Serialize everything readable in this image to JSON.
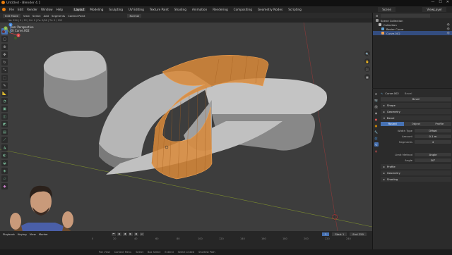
{
  "window": {
    "title": "Untitled - Blender 4.1",
    "minimize": "—",
    "maximize": "☐",
    "close": "✕"
  },
  "menu": {
    "items": [
      "File",
      "Edit",
      "Render",
      "Window",
      "Help"
    ],
    "workspaces": [
      "Layout",
      "Modeling",
      "Sculpting",
      "UV Editing",
      "Texture Paint",
      "Shading",
      "Animation",
      "Rendering",
      "Compositing",
      "Geometry Nodes",
      "Scripting"
    ],
    "active_workspace": "Layout",
    "scene": "Scene",
    "view_layer": "ViewLayer"
  },
  "viewport_header": {
    "mode": "Edit Mode",
    "items": [
      "View",
      "Select",
      "Add",
      "Segments",
      "Control Point"
    ],
    "transform_orientation": "Normal"
  },
  "tool_options": "Va: 224 | 0 / 12 | Ed: 0 | Fa: 0/96 | Tri: 0 / 192",
  "viewport_info": {
    "line1": "User Perspective",
    "line2": "(0) Curve.002"
  },
  "toolbar": {
    "icons": [
      "cursor-icon",
      "select-box-icon",
      "cursor-3d-icon",
      "move-icon",
      "rotate-icon",
      "scale-icon",
      "transform-icon",
      "annotate-icon",
      "measure-icon",
      "add-curve-icon",
      "extrude-icon",
      "inset-icon",
      "bevel-icon",
      "loop-cut-icon",
      "knife-icon",
      "poly-build-icon",
      "spin-icon",
      "smooth-icon",
      "shrink-icon",
      "shear-icon",
      "rip-icon"
    ]
  },
  "gizmo": {
    "x": "X",
    "y": "Y",
    "z": "Z"
  },
  "timeline": {
    "items": [
      "Playback",
      "Keying",
      "View",
      "Marker"
    ],
    "current_frame": "1",
    "start_label": "Start",
    "start": "1",
    "end_label": "End",
    "end": "250",
    "ticks": [
      "0",
      "20",
      "40",
      "60",
      "80",
      "100",
      "120",
      "140",
      "160",
      "180",
      "200",
      "220",
      "240"
    ]
  },
  "status_bar": [
    "Pan View",
    "Context Menu",
    "Select",
    "Box Select",
    "Extend",
    "Select Linked",
    "Shortest Path"
  ],
  "outliner": {
    "header": "Scene Collection",
    "rows": [
      {
        "label": "Scene Collection",
        "selected": false,
        "color": "#999999"
      },
      {
        "label": "Collection",
        "selected": false,
        "color": "#bbbbbb"
      },
      {
        "label": "Bezier Curve",
        "selected": false,
        "color": "#60a0d0"
      },
      {
        "label": "Curve.002",
        "selected": true,
        "color": "#f0a050"
      }
    ]
  },
  "properties": {
    "object_name": "Curve.002",
    "data_name": "Bevel",
    "panels": [
      "Shape",
      "Geometry",
      "Bevel"
    ],
    "section": "Bevel",
    "bevel_modes": [
      "Round",
      "Object",
      "Profile"
    ],
    "active_mode": "Round",
    "fields": [
      {
        "label": "Width Type",
        "value": "Offset"
      },
      {
        "label": "Amount",
        "value": "0.1 m"
      },
      {
        "label": "Segments",
        "value": "4"
      },
      {
        "label": "Limit Method",
        "value": "Angle"
      },
      {
        "label": "Angle",
        "value": "30°"
      }
    ],
    "subpanels": [
      "Profile",
      "Geometry",
      "Shading"
    ]
  },
  "colors": {
    "accent": "#4772b3",
    "selection_orange": "#e8953c",
    "viewport_bg": "#3d3d3d"
  }
}
